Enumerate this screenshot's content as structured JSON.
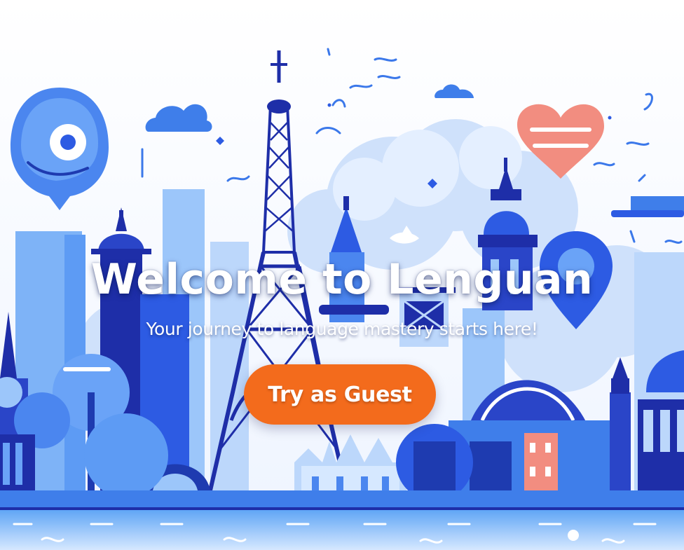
{
  "hero": {
    "title": "Welcome to Lenguan",
    "subtitle": "Your journey to language mastery starts here!",
    "cta_label": "Try as Guest"
  },
  "theme": {
    "primary_blue": "#2d5be3",
    "deep_blue": "#1e2ea8",
    "light_blue": "#bcd7fb",
    "accent_orange": "#f36b1c",
    "accent_salmon": "#f08a7a",
    "text_white": "#ffffff"
  },
  "illustration": {
    "subject": "city-skyline",
    "icons": [
      "eiffel-tower-icon",
      "heart-icon",
      "cloud-icon",
      "map-pin-icon",
      "speech-bubble-icon"
    ]
  }
}
